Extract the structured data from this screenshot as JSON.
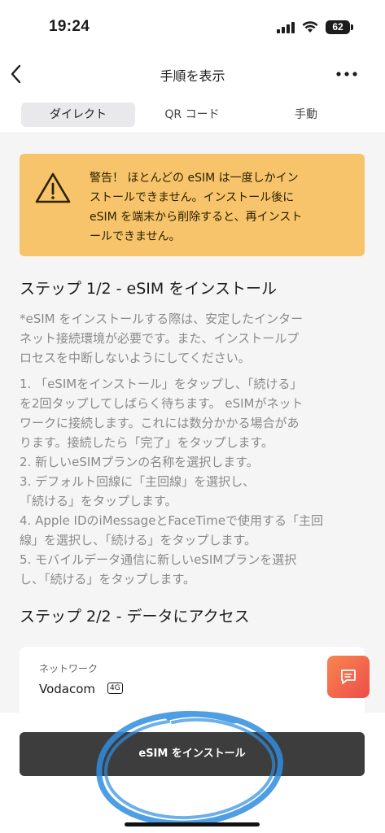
{
  "status": {
    "time": "19:24",
    "battery": "62"
  },
  "nav": {
    "title": "手順を表示"
  },
  "tabs": [
    {
      "label": "ダイレクト",
      "active": true
    },
    {
      "label": "QR コード",
      "active": false
    },
    {
      "label": "手動",
      "active": false
    }
  ],
  "warning": {
    "lines": [
      "警告！ ほとんどの eSIM は一度しかイン",
      "ストールできません。インストール後に",
      "eSIM を端末から削除すると、再インスト",
      "ールできません。"
    ]
  },
  "step1": {
    "title": "ステップ 1/2 - eSIM をインストール",
    "note_lines": [
      "*eSIM をインストールする際は、安定したインター",
      "ネット接続環境が必要です。また、インストールプ",
      "ロセスを中断しないようにしてください。"
    ],
    "instruction_lines": [
      "1. 「eSIMをインストール」をタップし、「続ける」",
      "を2回タップしてしばらく待ちます。 eSIMがネット",
      "ワークに接続します。これには数分かかる場合があ",
      "ります。接続したら「完了」をタップします。",
      "2. 新しいeSIMプランの名称を選択します。",
      "3. デフォルト回線に「主回線」を選択し、",
      "「続ける」をタップします。",
      "4. Apple IDのiMessageとFaceTimeで使用する「主回",
      "線」を選択し、「続ける」をタップします。",
      "5. モバイルデータ通信に新しいeSIMプランを選択",
      "し、「続ける」をタップします。"
    ]
  },
  "step2": {
    "title": "ステップ 2/2 - データにアクセス"
  },
  "network": {
    "label": "ネットワーク",
    "value": "Vodacom",
    "badge": "4G"
  },
  "install_button": {
    "label": "eSIM をインストール"
  },
  "colors": {
    "warning_bg": "#f7c46b",
    "button_bg": "#3d3d3d",
    "fab_start": "#f7864e",
    "fab_end": "#ef4d4a",
    "annotation": "#2f8de0"
  }
}
